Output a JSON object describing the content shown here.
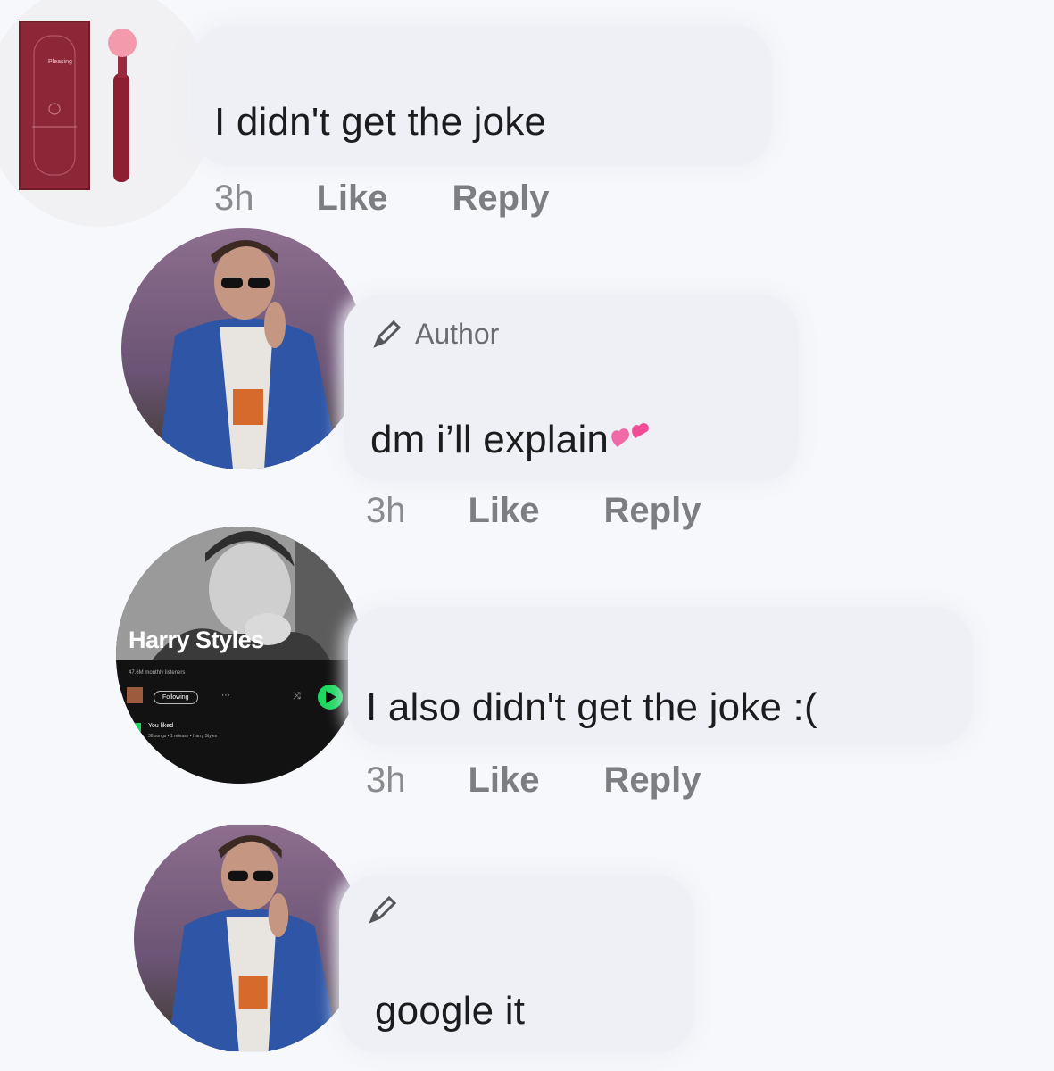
{
  "comments": [
    {
      "text": "I didn't get the joke",
      "time": "3h",
      "like": "Like",
      "reply": "Reply",
      "avatar": "product-box-avatar",
      "box_brand": "Pleasing"
    },
    {
      "author_label": "Author",
      "text": "dm i’ll explain",
      "emoji": "two-hearts",
      "time": "3h",
      "like": "Like",
      "reply": "Reply",
      "avatar": "photo-avatar"
    },
    {
      "text": "I also didn't get the joke :(",
      "time": "3h",
      "like": "Like",
      "reply": "Reply",
      "avatar": "spotify-artist-avatar"
    },
    {
      "text": "google it",
      "avatar": "photo-avatar"
    }
  ],
  "spotify_card": {
    "artist": "Harry Styles",
    "listeners": "47.6M monthly listeners",
    "follow_label": "Following",
    "liked_label": "You liked",
    "liked_sub": "36 songs • 1 release • Harry Styles",
    "accent": "#1ed760"
  },
  "colors": {
    "bubble": "#eef0f6",
    "background": "#f7f8fb",
    "box": "#8c2737",
    "jacket": "#2f56a6"
  }
}
